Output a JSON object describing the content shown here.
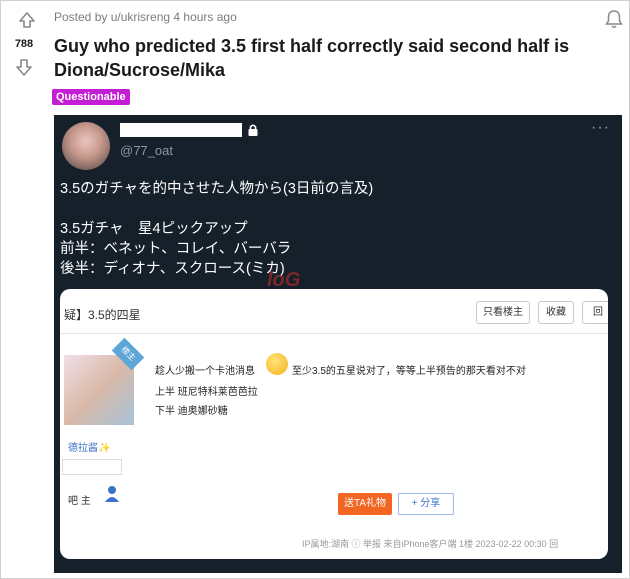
{
  "post": {
    "score": "788",
    "meta": "Posted by u/ukrisreng 4 hours ago",
    "title": "Guy who predicted 3.5 first half correctly said second half is Diona/Sucrose/Mika",
    "flair": "Questionable",
    "flair_color": "#c41ed4"
  },
  "tweet": {
    "handle": "@77_oat",
    "more": "···",
    "line1": "3.5のガチャを的中させた人物から(3日前の言及)",
    "line2": "3.5ガチャ　星4ピックアップ",
    "line3": "前半：ベネット、コレイ、バーバラ",
    "line4": "後半：ディオナ、スクロース(ミカ)",
    "bg_color": "#15202b"
  },
  "watermark": "loG",
  "forum": {
    "title": "疑】3.5的四星",
    "btn_author_only": "只看楼主",
    "btn_collect": "收藏",
    "btn_reply": "回",
    "ribbon": "楼主",
    "username": "德拉酱✨",
    "host_label": "吧 主",
    "post_line1a": "趁人少搬一个卡池消息",
    "post_line1b": "至少3.5的五星说对了，等等上半预告的那天看对不对",
    "post_line2": "上半 班尼特科莱芭芭拉",
    "post_line3": "下半 迪奥娜砂糖",
    "gift_btn": "送TA礼物",
    "share_btn": "+ 分享",
    "footer": "IP属地:湖南 ⓘ 举报  来自iPhone客户端  1楼  2023-02-22 00:30  回"
  },
  "icons": {
    "upvote": "upvote-arrow-icon",
    "downvote": "downvote-arrow-icon",
    "bell": "bell-icon",
    "lock": "lock-icon"
  }
}
